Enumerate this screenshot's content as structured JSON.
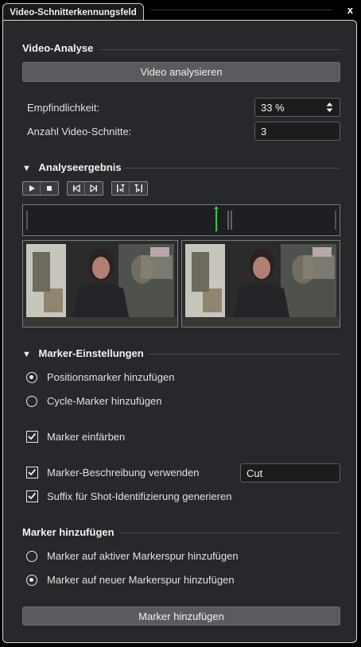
{
  "window": {
    "tab_title": "Video-Schnitterkennungsfeld",
    "close_label": "x"
  },
  "video_analysis": {
    "title": "Video-Analyse",
    "analyze_button": "Video analysieren",
    "sensitivity_label": "Empfindlichkeit:",
    "sensitivity_value": "33 %",
    "cuts_label": "Anzahl Video-Schnitte:",
    "cuts_value": "3"
  },
  "analysis_result": {
    "title": "Analyseergebnis",
    "transport_icons": [
      "play-icon",
      "stop-icon",
      "previous-icon",
      "next-icon",
      "previous-cut-icon",
      "next-cut-icon"
    ],
    "playhead_color": "#2ecc40"
  },
  "marker_settings": {
    "title": "Marker-Einstellungen",
    "position_marker_label": "Positionsmarker hinzufügen",
    "cycle_marker_label": "Cycle-Marker hinzufügen",
    "selected_type": "position",
    "color_marker_label": "Marker einfärben",
    "color_marker_checked": true,
    "description_label": "Marker-Beschreibung verwenden",
    "description_checked": true,
    "description_value": "Cut",
    "suffix_label": "Suffix für Shot-Identifizierung generieren",
    "suffix_checked": true
  },
  "add_markers": {
    "title": "Marker hinzufügen",
    "active_track_label": "Marker auf aktiver Markerspur hinzufügen",
    "new_track_label": "Marker auf neuer Markerspur hinzufügen",
    "selected": "new",
    "add_button": "Marker hinzufügen"
  }
}
